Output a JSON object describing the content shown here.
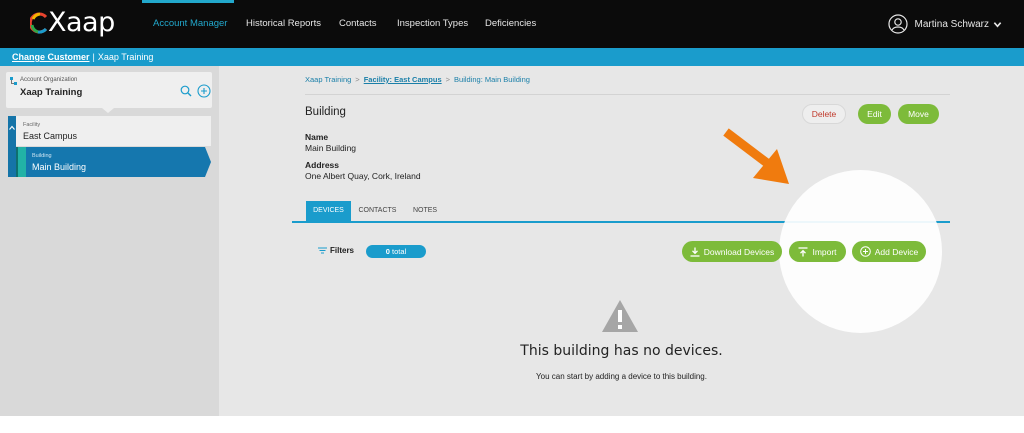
{
  "app": {
    "brand": "Xaap"
  },
  "nav": {
    "items": [
      {
        "label": "Account Manager",
        "active": true
      },
      {
        "label": "Historical Reports"
      },
      {
        "label": "Contacts"
      },
      {
        "label": "Inspection Types"
      },
      {
        "label": "Deficiencies"
      }
    ],
    "user_name": "Martina Schwarz"
  },
  "customer_bar": {
    "change_label": "Change Customer",
    "separator": "|",
    "customer": "Xaap Training"
  },
  "sidebar": {
    "org_caption": "Account Organization",
    "org_name": "Xaap Training",
    "facility_caption": "Facility",
    "facility_name": "East Campus",
    "building_caption": "Building",
    "building_name": "Main Building"
  },
  "breadcrumb": {
    "root": "Xaap Training",
    "sep1": ">",
    "facility": "Facility: East Campus",
    "sep2": ">",
    "current": "Building: Main Building"
  },
  "header": {
    "title": "Building",
    "delete_label": "Delete",
    "edit_label": "Edit",
    "move_label": "Move"
  },
  "details": {
    "name_label": "Name",
    "name_value": "Main Building",
    "address_label": "Address",
    "address_value": "One Albert Quay, Cork, Ireland"
  },
  "tabs": [
    {
      "label": "DEVICES",
      "active": true
    },
    {
      "label": "CONTACTS"
    },
    {
      "label": "NOTES"
    }
  ],
  "toolbar": {
    "filters_label": "Filters",
    "total_count": "0",
    "total_suffix": "total",
    "download_label": "Download Devices",
    "import_label": "Import",
    "add_device_label": "Add Device"
  },
  "empty_state": {
    "title": "This building has no devices.",
    "subtitle": "You can start by adding a device to this building."
  },
  "colors": {
    "accent": "#1a9ccc",
    "green": "#7dbb3a",
    "arrow": "#f07b0e",
    "delete": "#c0392b"
  }
}
